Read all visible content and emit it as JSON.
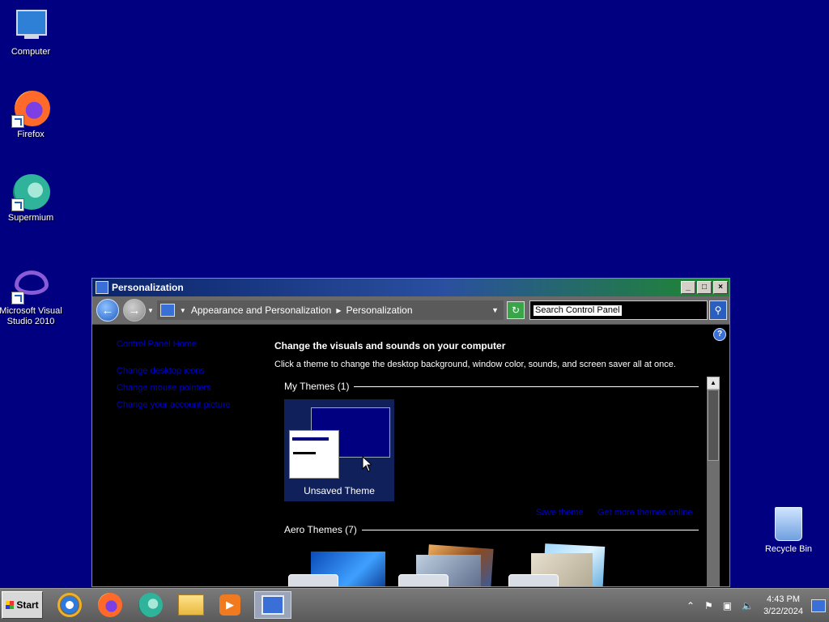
{
  "desktop": {
    "background_color": "#000080",
    "icons": [
      {
        "label": "Computer",
        "icon": "computer-icon"
      },
      {
        "label": "Firefox",
        "icon": "firefox-icon"
      },
      {
        "label": "Supermium",
        "icon": "supermium-icon"
      },
      {
        "label_line1": "Microsoft Visual",
        "label_line2": "Studio 2010",
        "icon": "visual-studio-icon"
      }
    ],
    "recycle_bin": {
      "label": "Recycle Bin",
      "icon": "recycle-bin-icon"
    }
  },
  "window": {
    "title": "Personalization",
    "controls": {
      "minimize": "_",
      "maximize": "□",
      "close": "×"
    },
    "address": {
      "crumbs": [
        "Appearance and Personalization",
        "Personalization"
      ],
      "search_placeholder": "Search Control Panel"
    },
    "sidebar": {
      "home": "Control Panel Home",
      "links": [
        "Change desktop icons",
        "Change mouse pointers",
        "Change your account picture"
      ]
    },
    "main": {
      "heading": "Change the visuals and sounds on your computer",
      "subheading": "Click a theme to change the desktop background, window color, sounds, and screen saver all at once.",
      "my_themes_label": "My Themes (1)",
      "unsaved_theme_label": "Unsaved Theme",
      "save_theme_link": "Save theme",
      "get_more_link": "Get more themes online",
      "aero_themes_label": "Aero Themes (7)"
    }
  },
  "taskbar": {
    "start_label": "Start",
    "apps": [
      "internet-explorer-icon",
      "firefox-icon",
      "supermium-icon",
      "file-explorer-icon",
      "media-player-icon",
      "control-panel-icon"
    ],
    "clock_time": "4:43 PM",
    "clock_date": "3/22/2024"
  }
}
